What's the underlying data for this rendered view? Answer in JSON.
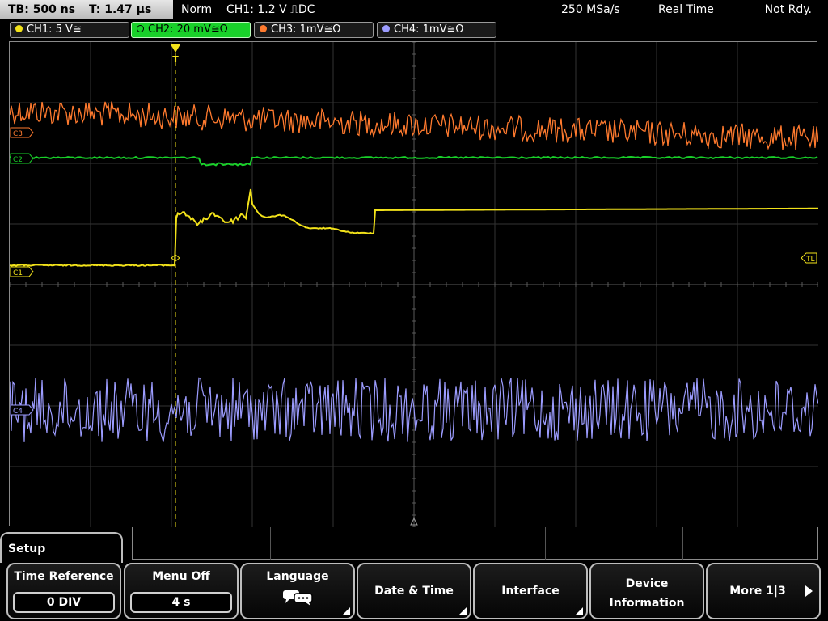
{
  "topbar": {
    "timebase": "TB: 500 ns",
    "trigger_time": "T: 1.47 µs",
    "trigger_mode": "Norm",
    "trigger_info": "CH1: 1.2 V ⎍DC",
    "sample_rate": "250 MSa/s",
    "acquisition": "Real Time",
    "status": "Not Rdy."
  },
  "channels": [
    {
      "label": "CH1: 5 V≅",
      "color": "#f2e21a",
      "active": false
    },
    {
      "label": "CH2: 20 mV≅Ω",
      "color": "#19d12a",
      "active": true
    },
    {
      "label": "CH3: 1mV≅Ω",
      "color": "#ff7a2e",
      "active": false
    },
    {
      "label": "CH4: 1mV≅Ω",
      "color": "#9c9cff",
      "active": false
    }
  ],
  "markers": {
    "c3": "C3",
    "c2": "C2",
    "c1": "C1",
    "c4": "C4",
    "trigger_level": "TL",
    "trigger_pos": "T"
  },
  "menu": {
    "title": "Setup",
    "softkeys": [
      {
        "label": "Time Reference",
        "value": "0 DIV"
      },
      {
        "label": "Menu Off",
        "value": "4 s"
      },
      {
        "label": "Language",
        "icon": "language-icon"
      },
      {
        "label": "Date & Time"
      },
      {
        "label": "Interface"
      },
      {
        "label": "Device Information"
      },
      {
        "label": "More 1|3"
      }
    ]
  }
}
